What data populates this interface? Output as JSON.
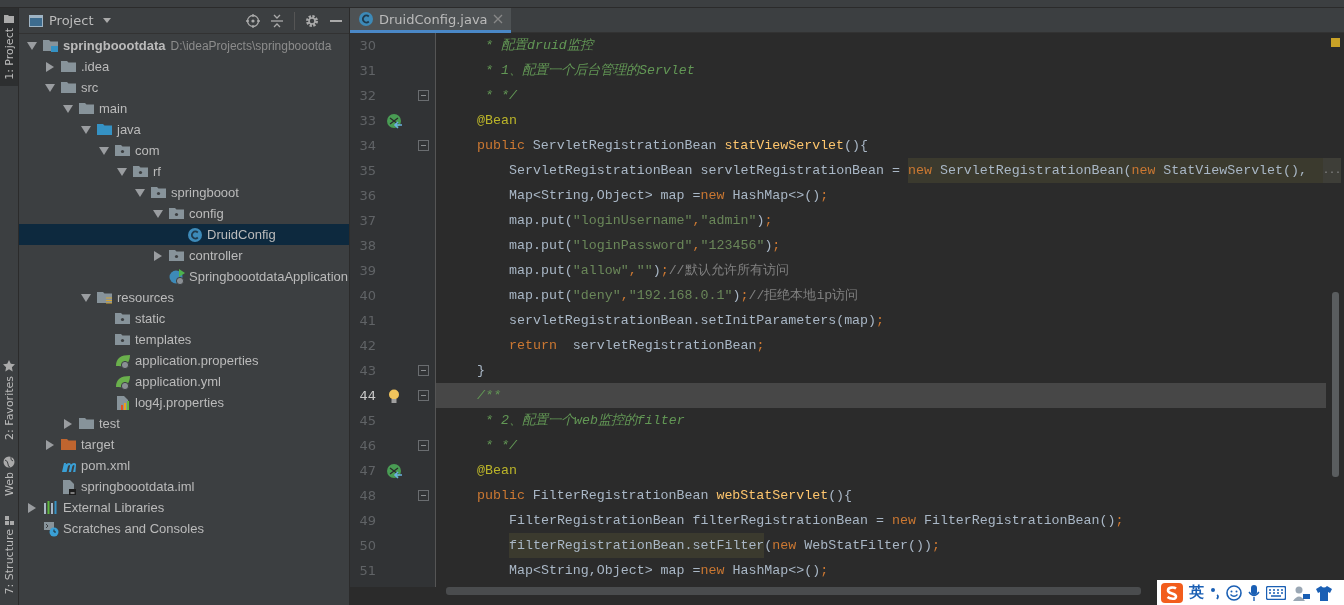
{
  "tool_strip": [
    {
      "label": "1: Project",
      "selected": true
    },
    {
      "label": "2: Favorites",
      "selected": false
    },
    {
      "label": "Web",
      "selected": false
    },
    {
      "label": "7: Structure",
      "selected": false
    }
  ],
  "project_panel": {
    "title": "Project",
    "tree": [
      {
        "label": "springboootdata",
        "path": "D:\\ideaProjects\\springboootda",
        "kind": "module",
        "expanded": true,
        "selected": false,
        "children": [
          {
            "label": ".idea",
            "kind": "folder",
            "expanded": false,
            "selected": false
          },
          {
            "label": "src",
            "kind": "folder",
            "expanded": true,
            "selected": false,
            "children": [
              {
                "label": "main",
                "kind": "folder",
                "expanded": true,
                "selected": false,
                "children": [
                  {
                    "label": "java",
                    "kind": "source",
                    "expanded": true,
                    "selected": false,
                    "children": [
                      {
                        "label": "com",
                        "kind": "package",
                        "expanded": true,
                        "selected": false,
                        "children": [
                          {
                            "label": "rf",
                            "kind": "package",
                            "expanded": true,
                            "selected": false,
                            "children": [
                              {
                                "label": "springbooot",
                                "kind": "package",
                                "expanded": true,
                                "selected": false,
                                "children": [
                                  {
                                    "label": "config",
                                    "kind": "package",
                                    "expanded": true,
                                    "selected": false,
                                    "children": [
                                      {
                                        "label": "DruidConfig",
                                        "kind": "class",
                                        "selected": true
                                      }
                                    ]
                                  },
                                  {
                                    "label": "controller",
                                    "kind": "package",
                                    "expanded": false,
                                    "selected": false
                                  },
                                  {
                                    "label": "SpringboootdataApplication",
                                    "kind": "spring-app",
                                    "selected": false
                                  }
                                ]
                              }
                            ]
                          }
                        ]
                      }
                    ]
                  },
                  {
                    "label": "resources",
                    "kind": "resources",
                    "expanded": true,
                    "selected": false,
                    "children": [
                      {
                        "label": "static",
                        "kind": "package",
                        "selected": false
                      },
                      {
                        "label": "templates",
                        "kind": "package",
                        "selected": false
                      },
                      {
                        "label": "application.properties",
                        "kind": "spring-config",
                        "selected": false
                      },
                      {
                        "label": "application.yml",
                        "kind": "spring-config",
                        "selected": false
                      },
                      {
                        "label": "log4j.properties",
                        "kind": "properties",
                        "selected": false
                      }
                    ]
                  }
                ]
              },
              {
                "label": "test",
                "kind": "folder",
                "expanded": false,
                "selected": false
              }
            ]
          },
          {
            "label": "target",
            "kind": "excluded",
            "expanded": false,
            "selected": false
          },
          {
            "label": "pom.xml",
            "kind": "maven",
            "selected": false
          },
          {
            "label": "springboootdata.iml",
            "kind": "iml",
            "selected": false
          }
        ]
      },
      {
        "label": "External Libraries",
        "kind": "libraries",
        "expanded": false,
        "selected": false
      },
      {
        "label": "Scratches and Consoles",
        "kind": "scratches",
        "selected": false
      }
    ]
  },
  "editor": {
    "tabs": [
      {
        "label": "DruidConfig.java",
        "selected": true
      }
    ],
    "lines": [
      {
        "number": "30",
        "kind": "member",
        "current": false,
        "tokens": [
          {
            "text": " * 配置druid监控",
            "kind": "doc"
          }
        ]
      },
      {
        "number": "31",
        "kind": "member",
        "current": false,
        "tokens": [
          {
            "text": " * 1、配置一个后台管理的Servlet",
            "kind": "doc"
          }
        ]
      },
      {
        "number": "32",
        "kind": "member",
        "current": false,
        "fold": true,
        "tokens": [
          {
            "text": " * */",
            "kind": "doc"
          }
        ]
      },
      {
        "number": "33",
        "kind": "member",
        "current": false,
        "gutter": {
          "kind": "bean"
        },
        "tokens": [
          {
            "text": "@Bean",
            "kind": "annotation"
          }
        ]
      },
      {
        "number": "34",
        "kind": "member",
        "current": false,
        "fold": true,
        "tokens": [
          {
            "text": "public",
            "kind": "keyword"
          },
          {
            "text": " ServletRegistrationBean ",
            "kind": "plain"
          },
          {
            "text": "statViewServlet",
            "kind": "declaration"
          },
          {
            "text": "(){",
            "kind": "plain"
          }
        ]
      },
      {
        "number": "35",
        "kind": "statement",
        "current": false,
        "tokens": [
          {
            "text": "ServletRegistrationBean servletRegistrationBean = ",
            "kind": "plain"
          },
          {
            "text": "new",
            "kind": "keyword",
            "hl": true
          },
          {
            "text": " ServletRegistrationBean(",
            "kind": "plain",
            "hl": true
          },
          {
            "text": "new",
            "kind": "keyword",
            "hl": true
          },
          {
            "text": " StatViewServlet(),  ",
            "kind": "plain",
            "hl": true
          },
          {
            "text": "...",
            "kind": "folded",
            "hl": true
          }
        ]
      },
      {
        "number": "36",
        "kind": "statement",
        "current": false,
        "tokens": [
          {
            "text": "Map<String,Object> map =",
            "kind": "plain"
          },
          {
            "text": "new",
            "kind": "keyword"
          },
          {
            "text": " HashMap<>()",
            "kind": "plain"
          },
          {
            "text": ";",
            "kind": "keyword"
          }
        ]
      },
      {
        "number": "37",
        "kind": "statement",
        "current": false,
        "tokens": [
          {
            "text": "map.put(",
            "kind": "plain"
          },
          {
            "text": "\"loginUsername\"",
            "kind": "string"
          },
          {
            "text": ",",
            "kind": "keyword"
          },
          {
            "text": "\"admin\"",
            "kind": "string"
          },
          {
            "text": ")",
            "kind": "plain"
          },
          {
            "text": ";",
            "kind": "keyword"
          }
        ]
      },
      {
        "number": "38",
        "kind": "statement",
        "current": false,
        "tokens": [
          {
            "text": "map.put(",
            "kind": "plain"
          },
          {
            "text": "\"loginPassword\"",
            "kind": "string"
          },
          {
            "text": ",",
            "kind": "keyword"
          },
          {
            "text": "\"123456\"",
            "kind": "string"
          },
          {
            "text": ")",
            "kind": "plain"
          },
          {
            "text": ";",
            "kind": "keyword"
          }
        ]
      },
      {
        "number": "39",
        "kind": "statement",
        "current": false,
        "tokens": [
          {
            "text": "map.put(",
            "kind": "plain"
          },
          {
            "text": "\"allow\"",
            "kind": "string"
          },
          {
            "text": ",",
            "kind": "keyword"
          },
          {
            "text": "\"\"",
            "kind": "string"
          },
          {
            "text": ")",
            "kind": "plain"
          },
          {
            "text": ";",
            "kind": "keyword"
          },
          {
            "text": "//默认允许所有访问",
            "kind": "comment"
          }
        ]
      },
      {
        "number": "40",
        "kind": "statement",
        "current": false,
        "tokens": [
          {
            "text": "map.put(",
            "kind": "plain"
          },
          {
            "text": "\"deny\"",
            "kind": "string"
          },
          {
            "text": ",",
            "kind": "keyword"
          },
          {
            "text": "\"192.168.0.1\"",
            "kind": "string"
          },
          {
            "text": ")",
            "kind": "plain"
          },
          {
            "text": ";",
            "kind": "keyword"
          },
          {
            "text": "//拒绝本地ip访问",
            "kind": "comment"
          }
        ]
      },
      {
        "number": "41",
        "kind": "statement",
        "current": false,
        "tokens": [
          {
            "text": "servletRegistrationBean.setInitParameters(map)",
            "kind": "plain"
          },
          {
            "text": ";",
            "kind": "keyword"
          }
        ]
      },
      {
        "number": "42",
        "kind": "statement",
        "current": false,
        "tokens": [
          {
            "text": "return",
            "kind": "keyword"
          },
          {
            "text": "  servletRegistrationBean",
            "kind": "plain"
          },
          {
            "text": ";",
            "kind": "keyword"
          }
        ]
      },
      {
        "number": "43",
        "kind": "member",
        "current": false,
        "fold": true,
        "tokens": [
          {
            "text": "}",
            "kind": "plain"
          }
        ]
      },
      {
        "number": "44",
        "kind": "member",
        "current": true,
        "fold": true,
        "gutter": {
          "kind": "bulb"
        },
        "tokens": [
          {
            "text": "/**",
            "kind": "doc"
          }
        ]
      },
      {
        "number": "45",
        "kind": "member",
        "current": false,
        "tokens": [
          {
            "text": " * 2、配置一个web监控的filter",
            "kind": "doc"
          }
        ]
      },
      {
        "number": "46",
        "kind": "member",
        "current": false,
        "fold": true,
        "tokens": [
          {
            "text": " * */",
            "kind": "doc"
          }
        ]
      },
      {
        "number": "47",
        "kind": "member",
        "current": false,
        "gutter": {
          "kind": "bean"
        },
        "tokens": [
          {
            "text": "@Bean",
            "kind": "annotation"
          }
        ]
      },
      {
        "number": "48",
        "kind": "member",
        "current": false,
        "fold": true,
        "tokens": [
          {
            "text": "public",
            "kind": "keyword"
          },
          {
            "text": " FilterRegistrationBean ",
            "kind": "plain"
          },
          {
            "text": "webStatServlet",
            "kind": "declaration"
          },
          {
            "text": "(){",
            "kind": "plain"
          }
        ]
      },
      {
        "number": "49",
        "kind": "statement",
        "current": false,
        "tokens": [
          {
            "text": "FilterRegistrationBean filterRegistrationBean = ",
            "kind": "plain"
          },
          {
            "text": "new",
            "kind": "keyword"
          },
          {
            "text": " FilterRegistrationBean()",
            "kind": "plain"
          },
          {
            "text": ";",
            "kind": "keyword"
          }
        ]
      },
      {
        "number": "50",
        "kind": "statement",
        "current": false,
        "tokens": [
          {
            "text": "filterRegistrationBean.setFilter",
            "kind": "plain",
            "hl": true
          },
          {
            "text": "(",
            "kind": "plain"
          },
          {
            "text": "new",
            "kind": "keyword"
          },
          {
            "text": " WebStatFilter())",
            "kind": "plain"
          },
          {
            "text": ";",
            "kind": "keyword"
          }
        ]
      },
      {
        "number": "51",
        "kind": "statement",
        "current": false,
        "tokens": [
          {
            "text": "Map<String,Object> map =",
            "kind": "plain"
          },
          {
            "text": "new",
            "kind": "keyword"
          },
          {
            "text": " HashMap<>()",
            "kind": "plain"
          },
          {
            "text": ";",
            "kind": "keyword"
          }
        ]
      }
    ]
  },
  "ime_toolbar": {
    "mode": "英"
  }
}
